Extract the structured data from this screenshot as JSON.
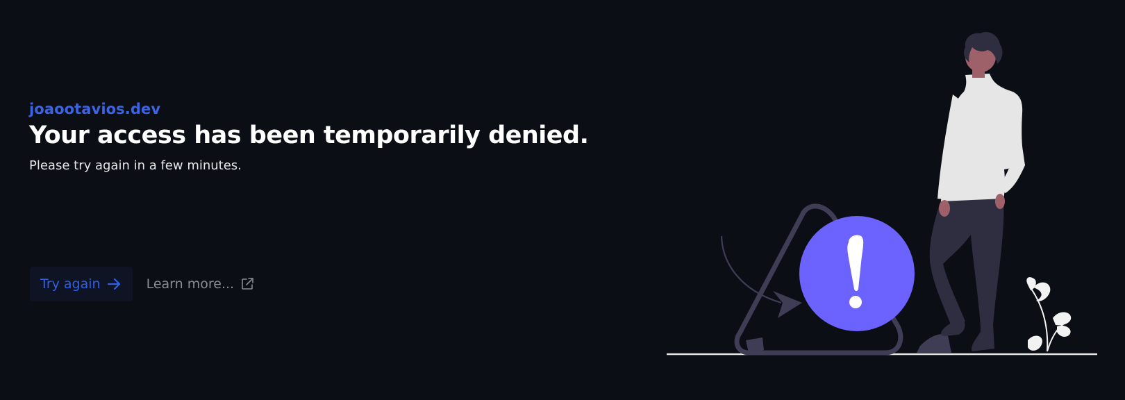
{
  "site": {
    "name": "joaootavios.dev"
  },
  "message": {
    "title": "Your access has been temporarily denied.",
    "subtitle": "Please try again in a few minutes."
  },
  "actions": {
    "try_again_label": "Try again",
    "learn_more_label": "Learn more..."
  },
  "icons": {
    "try_again": "arrow-right-icon",
    "learn_more": "external-link-icon",
    "illustration_badge": "exclamation-icon"
  },
  "colors": {
    "background": "#0b0e14",
    "accent": "#2f5fe5",
    "badge": "#6c63ff",
    "title": "#ffffff",
    "muted": "#8a8d94"
  }
}
